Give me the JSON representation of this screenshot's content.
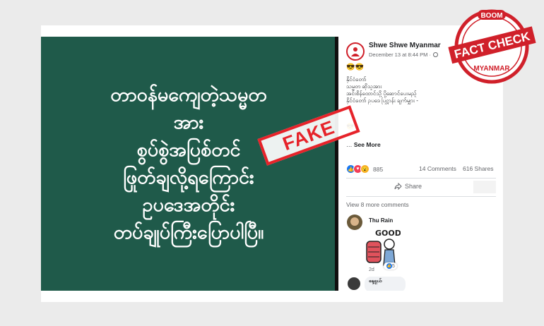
{
  "post_image": {
    "lines": [
      "တာဝန်မကျေတဲ့သမ္မတ",
      "အား",
      "စွပ်စွဲအပြစ်တင်",
      "ဖြုတ်ချလို့ရကြောင်း",
      "ဥပဒေအတိုင်း",
      "တပ်ချုပ်ကြီးပြောပါပြီ။"
    ]
  },
  "fake_stamp": {
    "label": "FAKE"
  },
  "badge": {
    "top": "BOOM",
    "middle": "FACT CHECK",
    "bottom": "MYANMAR"
  },
  "post": {
    "page_name": "Shwe Shwe Myanmar",
    "date": "December 13 at 8:44 PM ·",
    "emoji_top": "😎😎",
    "body_lines": [
      "နိုင်ငံတော်",
      "သမ္မတ ဆိုသူအား",
      "အင်းစိန်ထောင်သို့ ပို့ဆောင်ပေးမည့်",
      "နိုင်ငံတော် ဥပဒေ ပြဋ္ဌာန်း ချက်မျှား -"
    ],
    "emoji_mid": "😎",
    "see_more": "See More",
    "reaction_count": "885",
    "comments_count": "14 Comments",
    "shares_count": "616 Shares",
    "share_label": "Share",
    "view_more_comments": "View 8 more comments",
    "comments": [
      {
        "name": "Thu Rain",
        "sticker_text": "GOOD",
        "sticker_likes": "5",
        "time": "2d"
      },
      {
        "name": "နေ့ရှယ်",
        "partial_text": "နေ့ ယော"
      }
    ]
  },
  "colors": {
    "image_bg": "#1f5a4a",
    "stamp_red": "#e6232a",
    "fb_blue": "#1877f2"
  }
}
